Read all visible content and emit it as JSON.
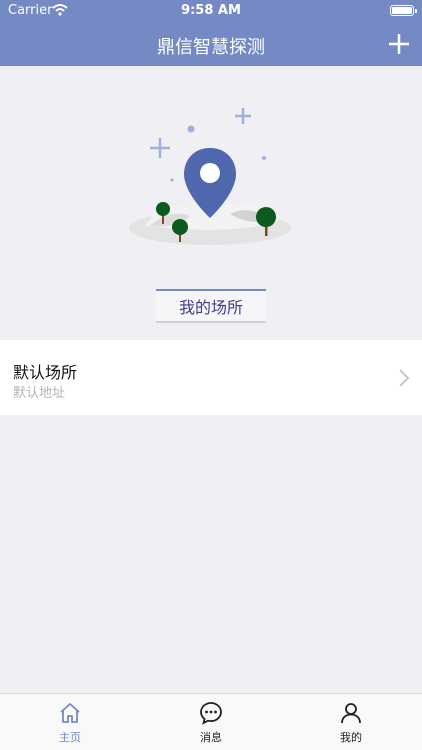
{
  "status_bar": {
    "carrier": "Carrier",
    "time": "9:58 AM"
  },
  "nav_bar": {
    "title": "鼎信智慧探测",
    "add_icon": "plus-icon"
  },
  "hero": {
    "illustration": "location-pin-illustration",
    "places_button": "我的场所"
  },
  "places": [
    {
      "name": "默认场所",
      "address": "默认地址"
    }
  ],
  "tab_bar": {
    "tabs": [
      {
        "label": "主页",
        "icon": "home-icon",
        "active": true
      },
      {
        "label": "消息",
        "icon": "message-icon",
        "active": false
      },
      {
        "label": "我的",
        "icon": "user-icon",
        "active": false
      }
    ]
  },
  "colors": {
    "accent": "#7589c4",
    "background": "#efeff4"
  }
}
